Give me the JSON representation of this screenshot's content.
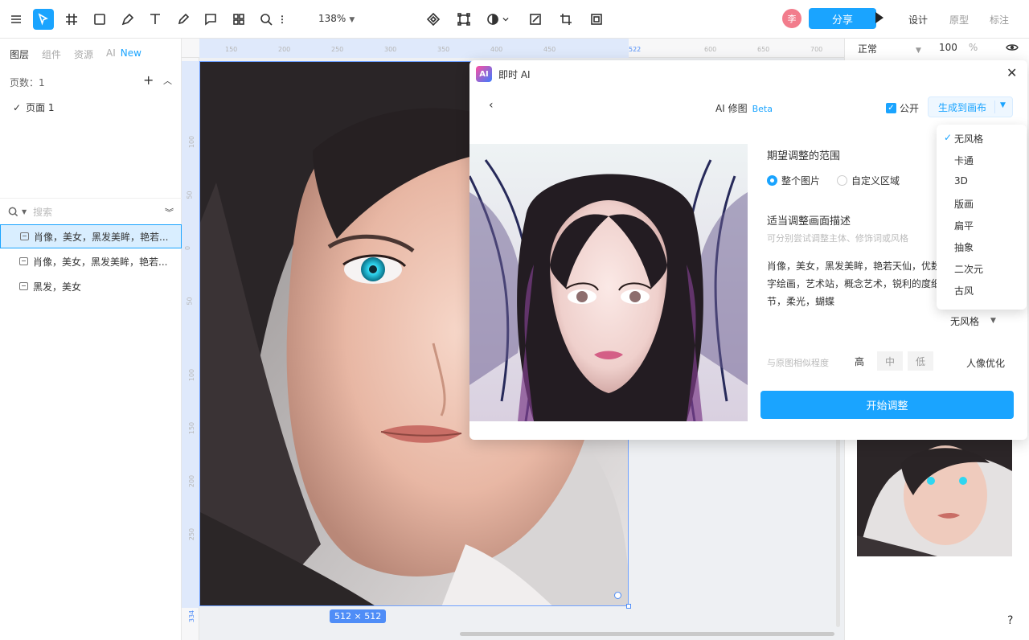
{
  "toolbar": {
    "zoom": "138%",
    "avatar_initial": "李",
    "share_label": "分享",
    "modes": [
      "设计",
      "原型",
      "标注"
    ]
  },
  "left_panel": {
    "tabs": [
      "图层",
      "组件",
      "资源",
      "AI"
    ],
    "new_badge": "New",
    "pages_count_label": "页数：1",
    "page_item": "页面 1",
    "search_placeholder": "搜索",
    "layers": [
      "肖像，美女，黑发美眸，艳若...",
      "肖像，美女，黑发美眸，艳若...",
      "黑发，美女"
    ]
  },
  "canvas": {
    "size_badge": "512 × 512",
    "ruler_marker": "522",
    "ruler_bottom": "334",
    "ruler_h": [
      "150",
      "200",
      "250",
      "300",
      "350",
      "400",
      "450",
      "600",
      "650",
      "700"
    ],
    "ruler_v": [
      "100",
      "50",
      "0",
      "50",
      "100",
      "150",
      "200",
      "250"
    ]
  },
  "right_panel": {
    "blend_mode": "正常",
    "opacity": "100",
    "opacity_unit": "%",
    "help": "?"
  },
  "ai_modal": {
    "title": "即时 AI",
    "logo_text": "AI",
    "heading": "AI 修图",
    "beta": "Beta",
    "public_label": "公开",
    "generate_target": "生成到画布",
    "range_title": "期望调整的范围",
    "range_options": [
      "整个图片",
      "自定义区域"
    ],
    "desc_title": "适当调整画面描述",
    "desc_hint": "可分别尝试调整主体、修饰词或风格",
    "prompt_text": "肖像，美女，黑发美眸，艳若天仙，优数字绘画，艺术站，概念艺术，锐利的度细节，柔光，蝴蝶",
    "style_value": "无风格",
    "similarity_label": "与原图相似程度",
    "similarity_options": [
      "高",
      "中",
      "低"
    ],
    "portrait_label": "人像优化",
    "start_label": "开始调整"
  },
  "style_dropdown": {
    "options": [
      "无风格",
      "卡通",
      "3D",
      "版画",
      "扁平",
      "抽象",
      "二次元",
      "古风"
    ],
    "selected": "无风格"
  },
  "colors": {
    "accent": "#1aa4ff",
    "selection": "#4f8df7"
  }
}
